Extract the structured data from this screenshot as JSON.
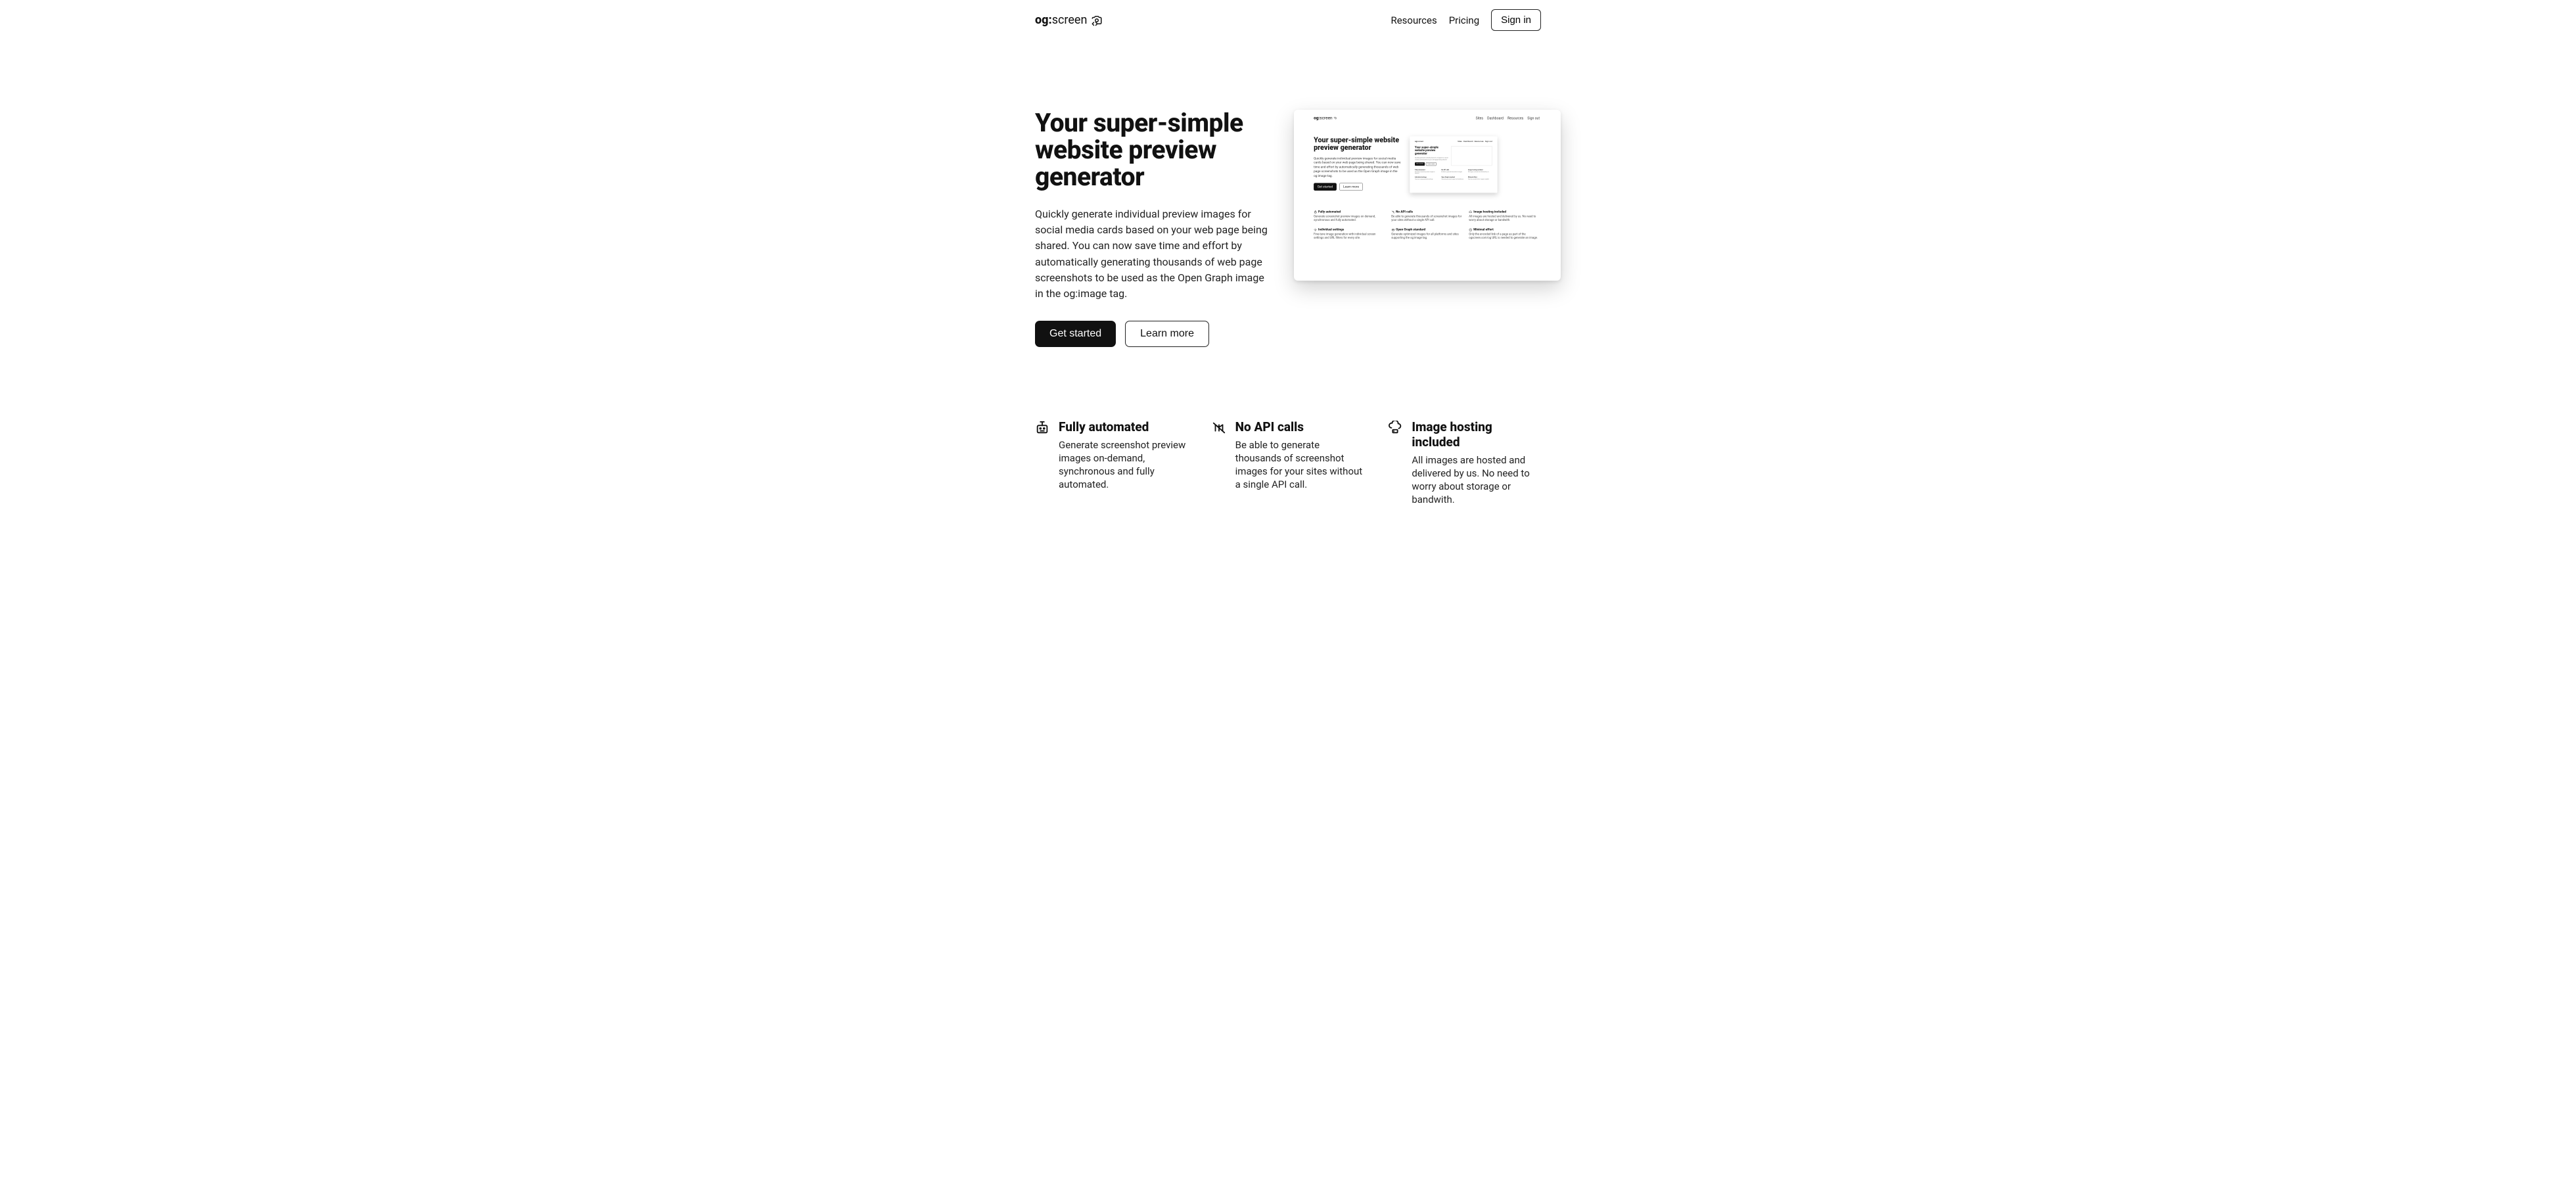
{
  "logo": {
    "prefix": "og:",
    "suffix": "screen"
  },
  "nav": {
    "resources": "Resources",
    "pricing": "Pricing",
    "signin": "Sign in"
  },
  "hero": {
    "headline": "Your super-simple website preview generator",
    "sub": "Quickly generate individual preview images for social media cards based on your web page being shared. You can now save time and effort by automatically generating thousands of web page screenshots to be used as the Open Graph image in the og:image tag.",
    "cta_primary": "Get started",
    "cta_secondary": "Learn more"
  },
  "preview": {
    "nav": [
      "Sites",
      "Dashboard",
      "Resources",
      "Sign out"
    ],
    "headline": "Your super-simple website preview generator",
    "sub": "Quickly generate individual preview images for social media cards based on your web page being shared. You can now save time and effort by automatically generating thousands of web page screenshots to be used as the Open Graph image in the og:image tag.",
    "cta_primary": "Get started",
    "cta_secondary": "Learn more",
    "features": [
      {
        "title": "Fully automated",
        "desc": "Generate screenshot preview images on demand, synchronous and fully automated."
      },
      {
        "title": "No API calls",
        "desc": "Be able to generate thousands of screenshot images for your sites without a single API call."
      },
      {
        "title": "Image hosting included",
        "desc": "All images are hosted and delivered by us. No need to worry about storage or bandwith."
      },
      {
        "title": "Individual settings",
        "desc": "Fine-tune image generation with individual screen settings and URL filters for every site."
      },
      {
        "title": "Open Graph standard",
        "desc": "Generate optimized images for all platforms and sites supporting the og:image tag."
      },
      {
        "title": "Minimal effort",
        "desc": "Only the encoded link of a page as part of the ogscreen.com/og URL is needed to generate an image."
      }
    ]
  },
  "features": [
    {
      "title": "Fully automated",
      "desc": "Generate screenshot preview images on-demand, synchronous and fully automated."
    },
    {
      "title": "No API calls",
      "desc": "Be able to generate thousands of screenshot images for your sites without a single API call."
    },
    {
      "title": "Image hosting included",
      "desc": "All images are hosted and delivered by us. No need to worry about storage or bandwith."
    }
  ]
}
